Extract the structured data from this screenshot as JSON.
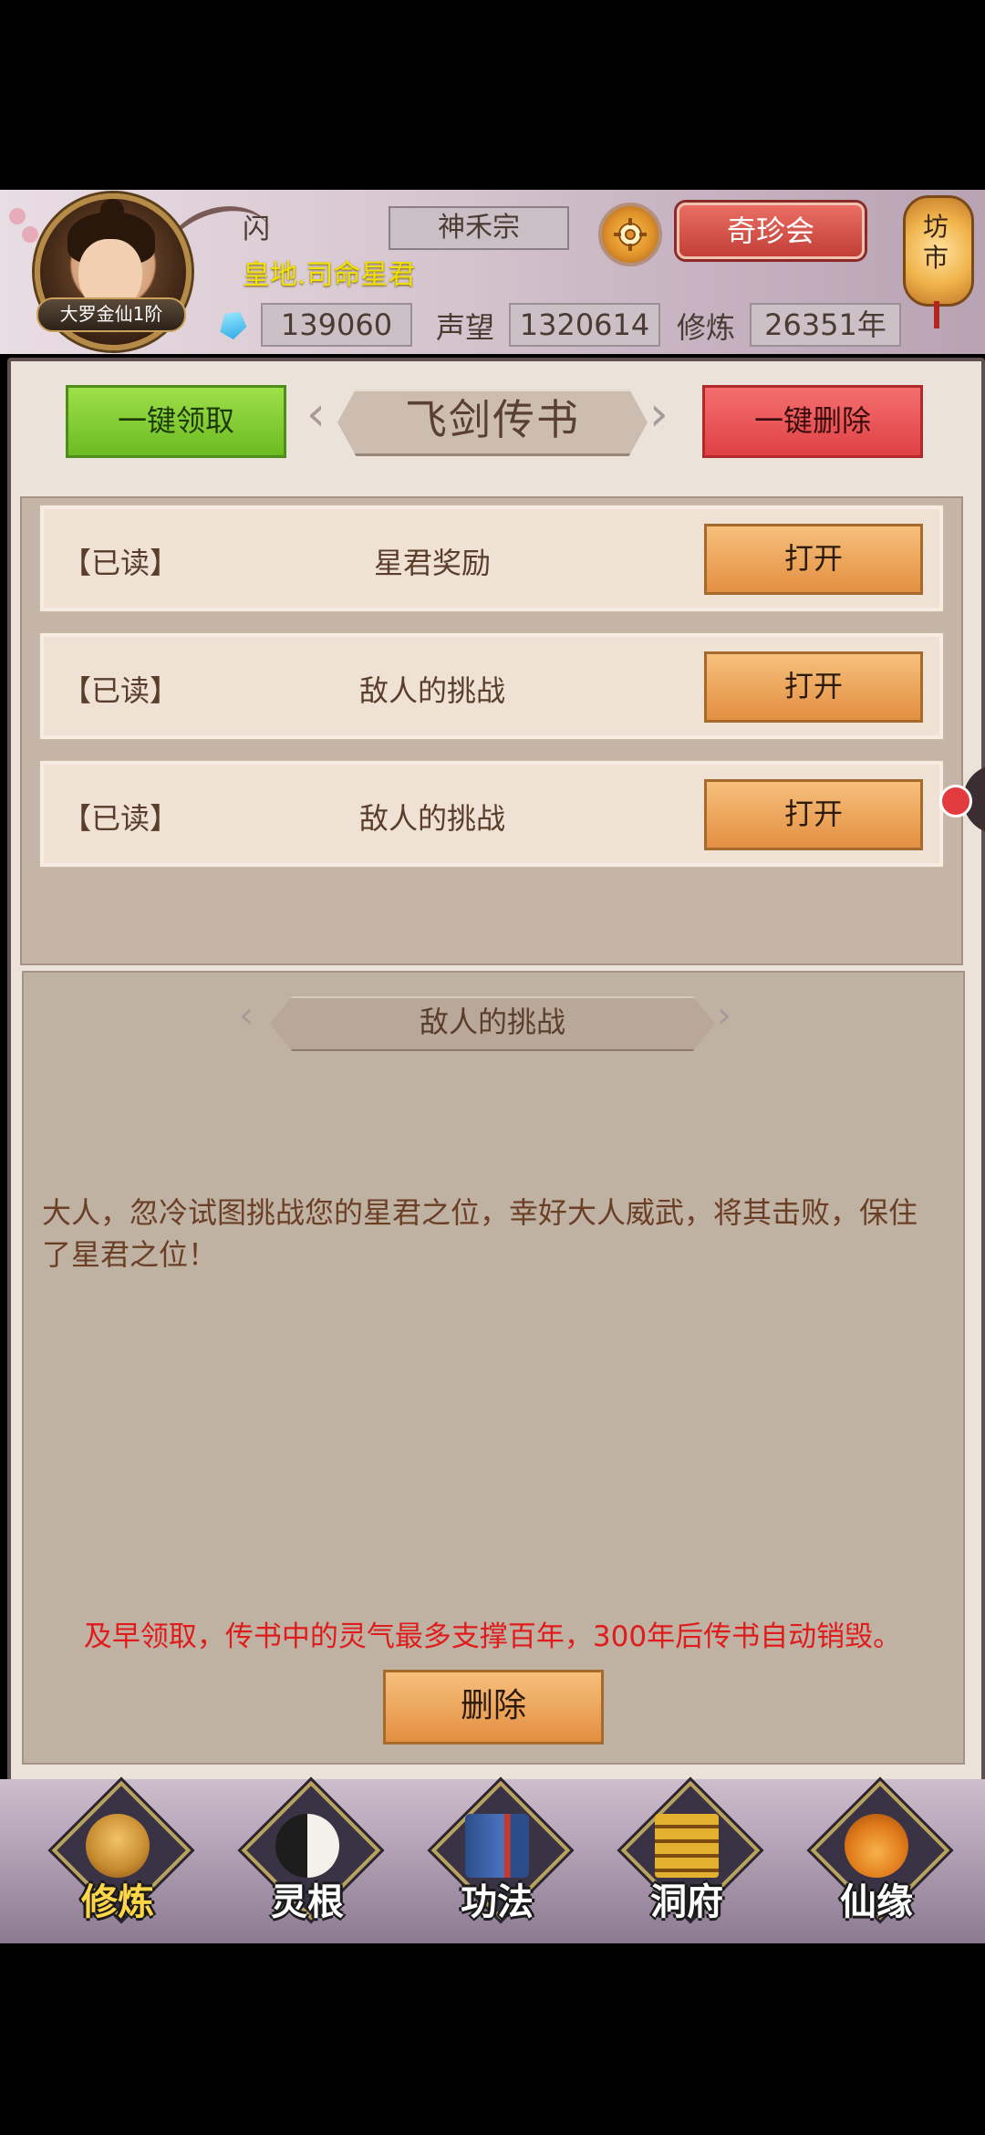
{
  "header": {
    "player_name": "闪",
    "player_title": "皇地.司命星君",
    "realm_badge": "大罗金仙1阶",
    "sect": "神禾宗",
    "treasure_button": "奇珍会",
    "market_button_line1": "坊",
    "market_button_line2": "市",
    "spirit_stones": "139060",
    "reputation_label": "声望",
    "reputation_value": "1320614",
    "cultivation_label": "修炼",
    "cultivation_value": "26351年"
  },
  "panel": {
    "title": "飞剑传书",
    "claim_all": "一键领取",
    "delete_all": "一键删除"
  },
  "mails": [
    {
      "status": "【已读】",
      "subject": "星君奖励",
      "action": "打开"
    },
    {
      "status": "【已读】",
      "subject": "敌人的挑战",
      "action": "打开"
    },
    {
      "status": "【已读】",
      "subject": "敌人的挑战",
      "action": "打开"
    }
  ],
  "detail": {
    "title": "敌人的挑战",
    "body": "大人，忽冷试图挑战您的星君之位，幸好大人威武，将其击败，保住了星君之位！",
    "warning": "及早领取，传书中的灵气最多支撑百年，300年后传书自动销毁。",
    "delete_button": "删除"
  },
  "bottom_nav": {
    "items": [
      {
        "label": "修炼",
        "icon": "monk-icon",
        "active": true
      },
      {
        "label": "灵根",
        "icon": "spirit-root-icon",
        "active": false
      },
      {
        "label": "功法",
        "icon": "scripture-book-icon",
        "active": false
      },
      {
        "label": "洞府",
        "icon": "pagoda-icon",
        "active": false
      },
      {
        "label": "仙缘",
        "icon": "gourd-icon",
        "active": false
      }
    ]
  },
  "colors": {
    "accent_green": "#7cc52c",
    "accent_red": "#e84d50",
    "accent_orange": "#eea256",
    "warning_red": "#e01b1b",
    "title_yellow": "#f2e100"
  }
}
